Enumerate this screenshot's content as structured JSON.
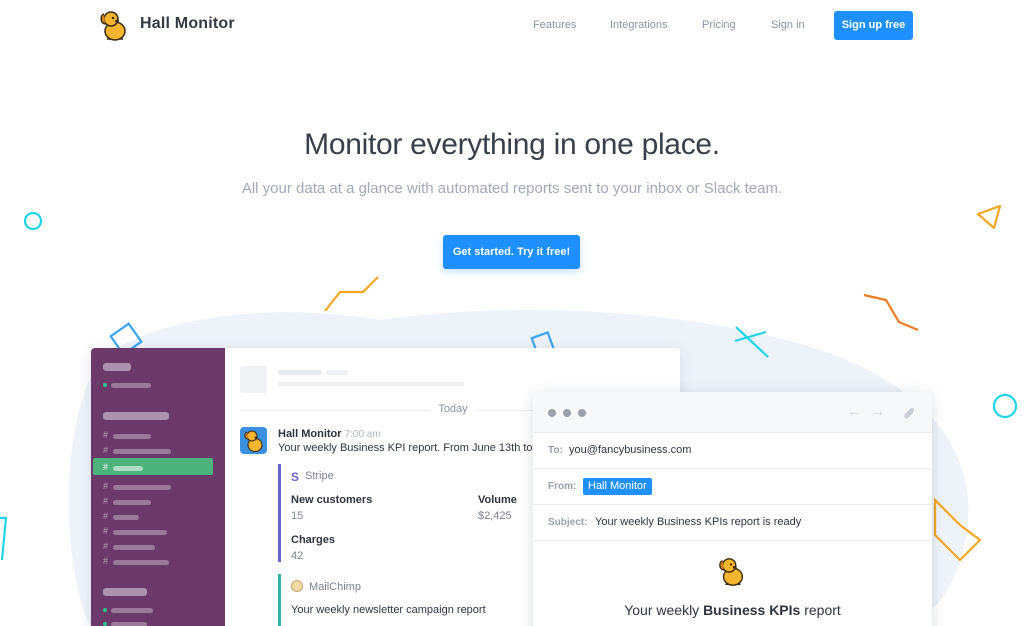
{
  "nav": {
    "brand": "Hall Monitor",
    "links": [
      "Features",
      "Integrations",
      "Pricing",
      "Sign in"
    ],
    "cta": "Sign up free"
  },
  "hero": {
    "title": "Monitor everything in one place.",
    "subtitle": "All your data at a glance with automated reports sent to your inbox or Slack team.",
    "cta": "Get started. Try it free!"
  },
  "slack": {
    "divider": "Today",
    "message": {
      "author": "Hall Monitor",
      "time": "7:00 am",
      "text": "Your weekly Business KPI report. From June 13th to"
    },
    "stripe": {
      "source": "Stripe",
      "fields": [
        {
          "label": "New customers",
          "value": "15"
        },
        {
          "label": "Volume",
          "value": "$2,425"
        },
        {
          "label": "Charges",
          "value": "42"
        }
      ]
    },
    "mailchimp": {
      "source": "MailChimp",
      "text": "Your weekly newsletter campaign report"
    }
  },
  "email": {
    "to_label": "To:",
    "to": "you@fancybusiness.com",
    "from_label": "From:",
    "from": "Hall Monitor",
    "subject_label": "Subject:",
    "subject": "Your weekly Business KPIs report is ready",
    "body_title_prefix": "Your weekly ",
    "body_title_bold": "Business KPIs",
    "body_title_suffix": " report"
  },
  "colors": {
    "accent": "#1e90ff",
    "slack_sidebar": "#6b3a6b",
    "slack_active": "#4cb37c",
    "stripe": "#6a62d2",
    "mailchimp": "#2fb8a8",
    "deco_cyan": "#21d4e8",
    "deco_orange": "#f5a623",
    "deco_blue": "#3aa3f0"
  },
  "icons": {
    "logo": "dog-mascot-icon",
    "back": "arrow-left-icon",
    "forward": "arrow-right-icon",
    "attach": "paperclip-icon",
    "stripe": "stripe-s-icon",
    "mailchimp": "mailchimp-icon"
  }
}
